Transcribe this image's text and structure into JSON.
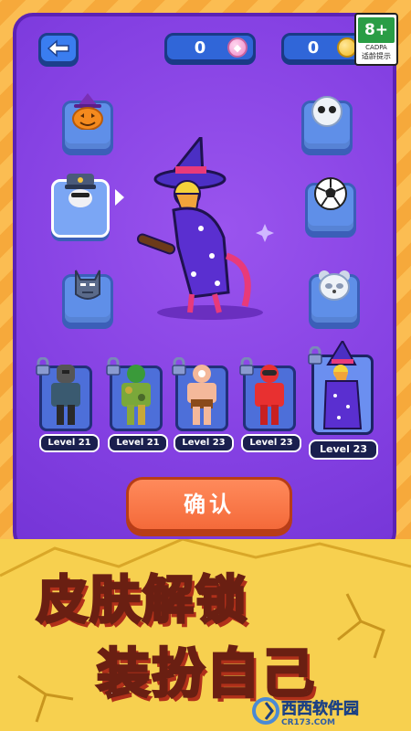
{
  "header": {
    "back_icon": "back-arrow-icon",
    "gems": "0",
    "coins": "0",
    "gem_icon": "gem-icon",
    "coin_icon": "coin-icon"
  },
  "age_rating": {
    "badge": "8+",
    "org": "CADPA",
    "note": "适龄提示"
  },
  "skin_slots_left": [
    {
      "name": "pumpkin-hat-icon"
    },
    {
      "name": "police-hat-icon"
    },
    {
      "name": "batman-mask-icon"
    }
  ],
  "skin_slots_right": [
    {
      "name": "ghost-mask-icon"
    },
    {
      "name": "soccer-ball-icon"
    },
    {
      "name": "panda-mask-icon"
    }
  ],
  "characters": [
    {
      "label": "Level 21",
      "name": "knight"
    },
    {
      "label": "Level 21",
      "name": "camo-soldier"
    },
    {
      "label": "Level 23",
      "name": "wrestler"
    },
    {
      "label": "Level 23",
      "name": "red-suit"
    },
    {
      "label": "Level 23",
      "name": "wizard"
    }
  ],
  "confirm_label": "确认",
  "headline": {
    "line1": "皮肤解锁",
    "line2": "装扮自己"
  },
  "watermark": {
    "name": "西西软件园",
    "url": "CR173.COM"
  },
  "colors": {
    "panel": "#8440e2",
    "slot": "#5f8fe8",
    "confirm": "#f46a3a",
    "background": "#f6a93b"
  }
}
